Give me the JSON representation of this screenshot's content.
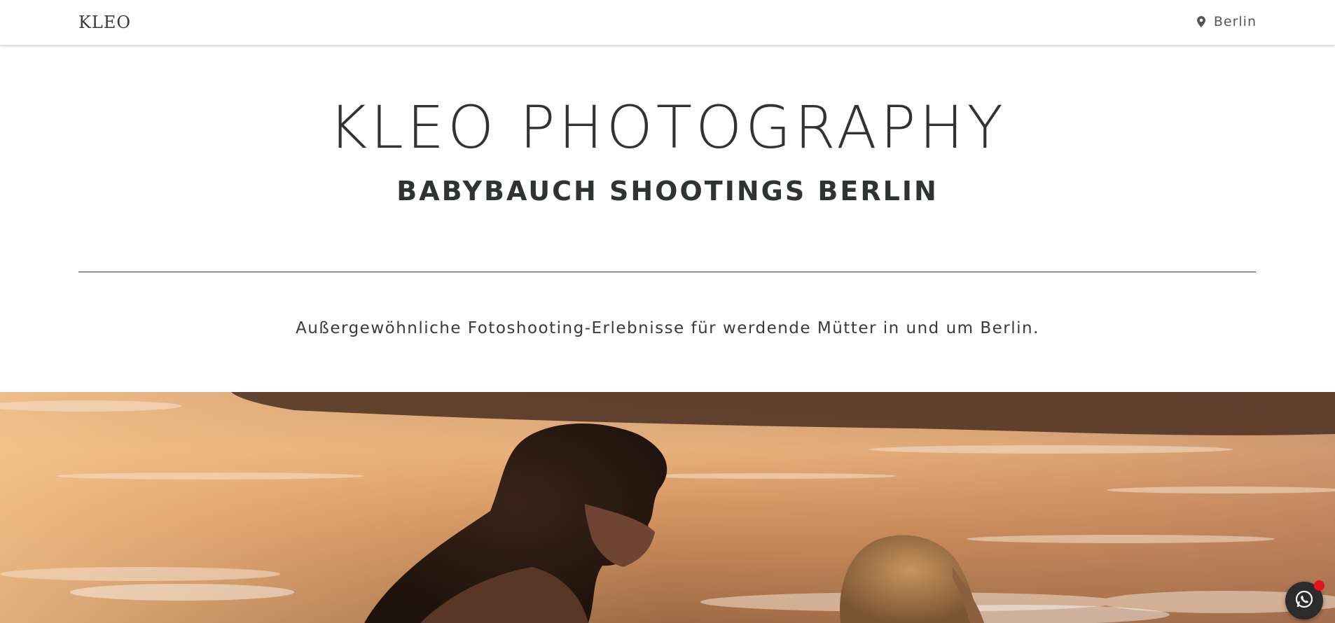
{
  "header": {
    "logo": "KLEO",
    "location_icon": "map-pin-icon",
    "location_label": "Berlin"
  },
  "hero": {
    "title": "KLEO PHOTOGRAPHY",
    "subtitle": "BABYBAUCH SHOOTINGS BERLIN",
    "tagline": "Außergewöhnliche Fotoshooting-Erlebnisse für werdende Mütter in und um Berlin."
  },
  "widgets": {
    "chat_icon": "whatsapp-icon",
    "notification_color": "#e8101a"
  },
  "colors": {
    "text": "#2f3331",
    "accent_dark": "#2b2b2b"
  }
}
